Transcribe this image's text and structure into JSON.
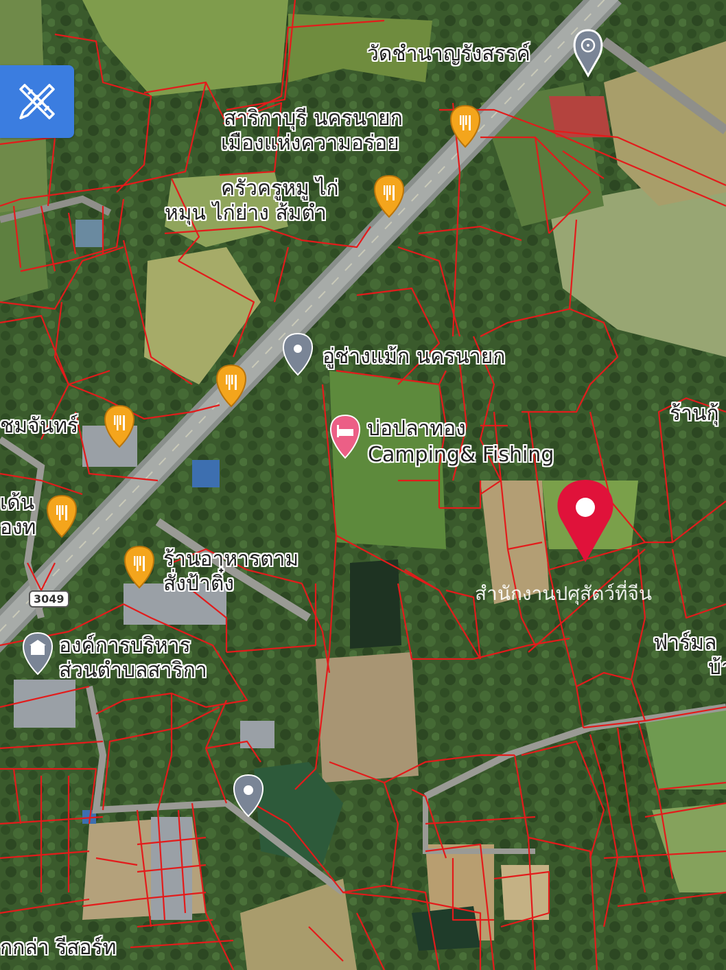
{
  "toolbar": {
    "measure_icon": "ruler-pencil-icon"
  },
  "road_shield": "3049",
  "labels": {
    "temple": "วัดชำนาญรังสรรค์",
    "saraburi_line1": "สาริกาบุรี นครนายก",
    "saraburi_line2": "เมืองแห่งความอร่อย",
    "krua_line1": "ครัวครูหมู ไก่",
    "krua_line2": "หมุน ไก่ย่าง ส้มตำ",
    "garage": "อู่ช่างแม้ก นครนายก",
    "pond_line1": "บ่อปลาทอง",
    "pond_line2": "Camping& Fishing",
    "somjan": "ชมจันทร์",
    "den_line1": "เด้น",
    "den_line2": "องท",
    "restaurant_line1": "ร้านอาหารตาม",
    "restaurant_line2": "สั่งป้าติ๋ง",
    "org_line1": "องค์การบริหาร",
    "org_line2": "ส่วนตำบลสาริกา",
    "right_top": "ร้านกุ้",
    "right_farm_line1": "ฟาร์มล",
    "right_farm_line2": "บ้า",
    "faint_label": "สำนักงานปศุสัตว์ที่จีน",
    "bottom_resort": "กกล่า รีสอร์ท"
  },
  "colors": {
    "parcel_line": "#e31b1b",
    "food_pin": "#f4a51c",
    "selected_pin": "#e0123a",
    "hotel_pin": "#ec5f86",
    "generic_pin": "#7a8596",
    "button": "#3b7de0"
  }
}
